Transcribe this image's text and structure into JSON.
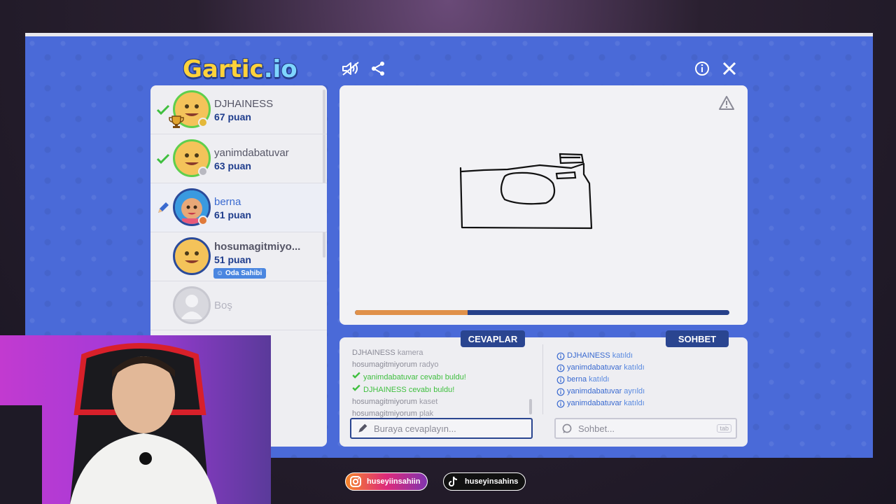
{
  "logo": {
    "text_a": "Gartic",
    "text_b": ".io"
  },
  "players": [
    {
      "name": "DJHAINESS",
      "score": "67 puan",
      "status": "guessed",
      "crown": true
    },
    {
      "name": "yanimdabatuvar",
      "score": "63 puan",
      "status": "guessed"
    },
    {
      "name": "berna",
      "score": "61 puan",
      "status": "drawing"
    },
    {
      "name": "hosumagitmiyo...",
      "score": "51 puan",
      "badge": "Oda Sahibi"
    },
    {
      "name": "Boş"
    }
  ],
  "progress": {
    "fraction": 0.3
  },
  "tabs": {
    "answers": "CEVAPLAR",
    "chat": "SOHBET"
  },
  "answers": [
    {
      "user": "DJHAINESS",
      "text": "kamera"
    },
    {
      "user": "hosumagitmiyorum",
      "text": "radyo"
    },
    {
      "user": "yanimdabatuvar",
      "text": "cevabı buldu!",
      "found": true
    },
    {
      "user": "DJHAINESS",
      "text": "cevabı buldu!",
      "found": true
    },
    {
      "user": "hosumagitmiyorum",
      "text": "kaset"
    },
    {
      "user": "hosumagitmiyorum",
      "text": "plak"
    }
  ],
  "chat_log": [
    {
      "user": "DJHAINESS",
      "action": "katıldı"
    },
    {
      "user": "yanimdabatuvar",
      "action": "katıldı"
    },
    {
      "user": "berna",
      "action": "katıldı"
    },
    {
      "user": "yanimdabatuvar",
      "action": "ayrıldı"
    },
    {
      "user": "yanimdabatuvar",
      "action": "katıldı"
    }
  ],
  "inputs": {
    "answer_placeholder": "Buraya cevaplayın...",
    "chat_placeholder": "Sohbet...",
    "chat_hint": "tab"
  },
  "social": {
    "instagram": "huseyiinsahiin",
    "tiktok": "huseyinsahins"
  },
  "colors": {
    "stage": "#4a6ad8",
    "accent": "#2a4590",
    "found": "#3fbf3f",
    "progress": "#e0914a"
  }
}
